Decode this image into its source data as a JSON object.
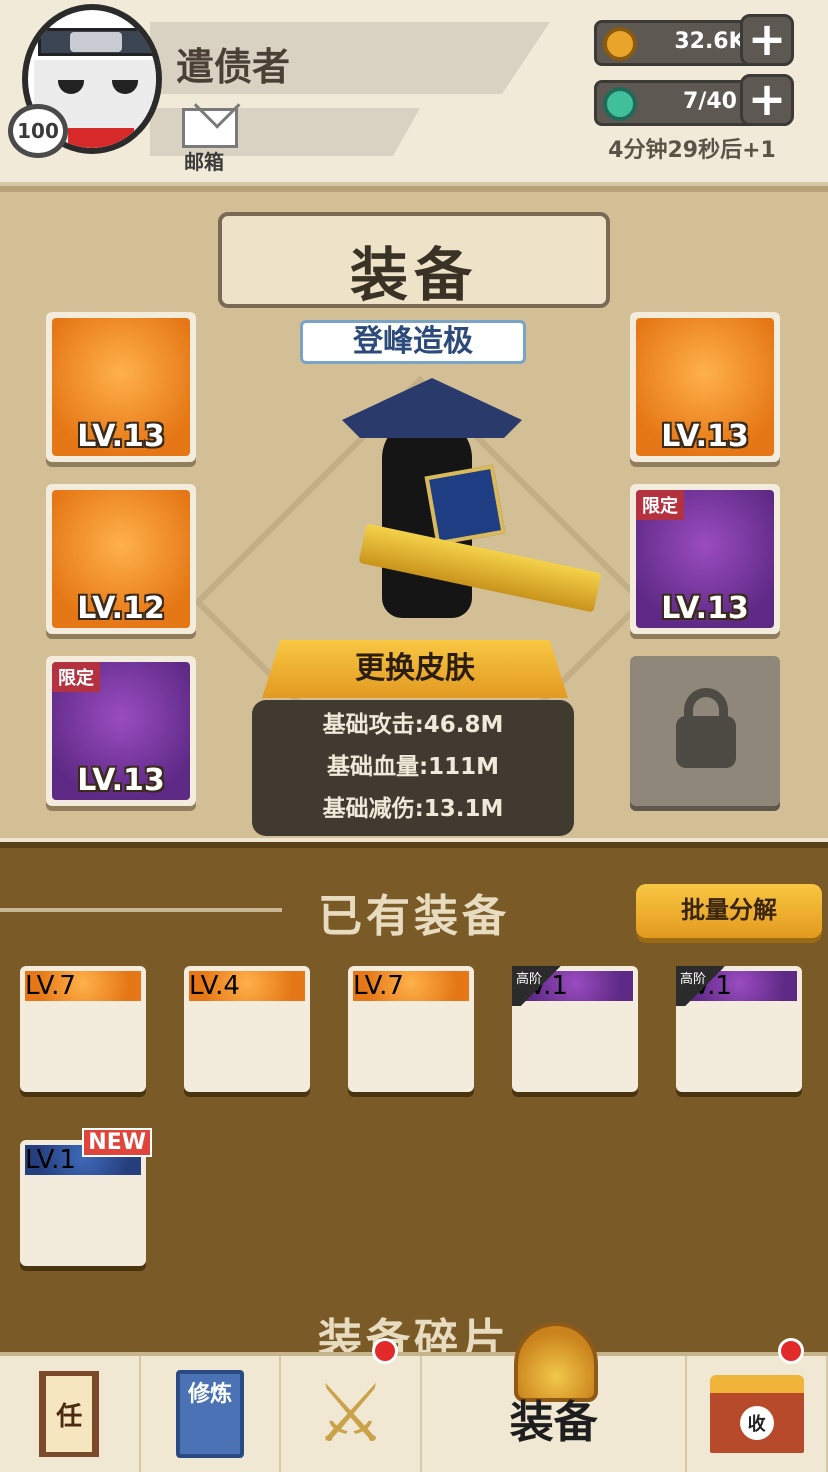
{
  "player": {
    "name": "遣债者",
    "level": "100",
    "mail_label": "邮箱"
  },
  "resources": {
    "coins": "32.6K",
    "stamina": "7/40",
    "timer": "4分钟29秒后+1"
  },
  "equipment_panel": {
    "title": "装备",
    "rank": "登峰造极",
    "skin_button": "更换皮肤",
    "stats": {
      "attack": "基础攻击:46.8M",
      "hp": "基础血量:111M",
      "damage_reduction": "基础减伤:13.1M"
    },
    "left_slots": [
      {
        "name": "golden-sword",
        "level": "LV.13",
        "tag": ""
      },
      {
        "name": "armor",
        "level": "LV.12",
        "tag": ""
      },
      {
        "name": "chinese-knot",
        "level": "LV.13",
        "tag": "限定"
      }
    ],
    "right_slots": [
      {
        "name": "straw-hat",
        "level": "LV.13",
        "tag": ""
      },
      {
        "name": "gold-ingot-pendant",
        "level": "LV.13",
        "tag": "限定"
      }
    ]
  },
  "owned": {
    "title": "已有装备",
    "batch_button": "批量分解",
    "items": [
      {
        "name": "spear",
        "level": "LV.7",
        "tag": "",
        "bg": "orange"
      },
      {
        "name": "key-blade",
        "level": "LV.4",
        "tag": "",
        "bg": "orange"
      },
      {
        "name": "robe",
        "level": "LV.7",
        "tag": "",
        "bg": "orange"
      },
      {
        "name": "red-gauntlet",
        "level": "LV.1",
        "tag": "高阶",
        "bg": "purple"
      },
      {
        "name": "amulet",
        "level": "LV.1",
        "tag": "高阶",
        "bg": "purple"
      },
      {
        "name": "jade-ring",
        "level": "LV.1",
        "tag": "NEW",
        "bg": "blue"
      }
    ]
  },
  "shards_title": "装备碎片",
  "nav": {
    "task_label": "任",
    "cultivate_label": "修炼",
    "equipment_label": "装备",
    "shop_label": "收"
  },
  "colors": {
    "gold": "#f8c742",
    "panel": "#d2bf96",
    "owned_bg": "#7a5a26",
    "orange_slot": "#e57716",
    "purple_slot": "#5f2a86"
  }
}
